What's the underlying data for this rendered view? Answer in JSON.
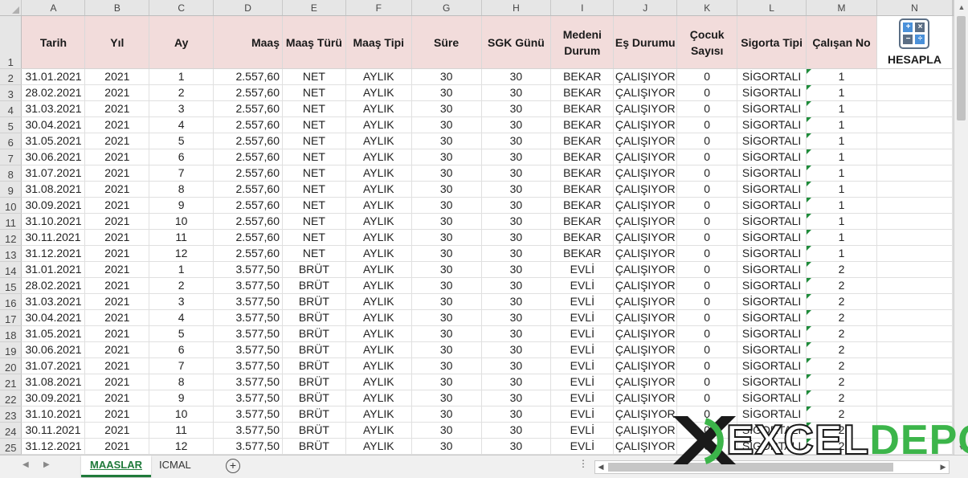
{
  "columns": [
    "A",
    "B",
    "C",
    "D",
    "E",
    "F",
    "G",
    "H",
    "I",
    "J",
    "K",
    "L",
    "M",
    "N"
  ],
  "headers": [
    "Tarih",
    "Yıl",
    "Ay",
    "Maaş",
    "Maaş Türü",
    "Maaş Tipi",
    "Süre",
    "SGK Günü",
    "Medeni Durum",
    "Eş Durumu",
    "Çocuk Sayısı",
    "Sigorta Tipi",
    "Çalışan No"
  ],
  "calc_button_label": "HESAPLA",
  "header_row_number": "1",
  "rows": [
    [
      "2",
      "31.01.2021",
      "2021",
      "1",
      "2.557,60",
      "NET",
      "AYLIK",
      "30",
      "30",
      "BEKAR",
      "ÇALIŞIYOR",
      "0",
      "SİGORTALI",
      "1"
    ],
    [
      "3",
      "28.02.2021",
      "2021",
      "2",
      "2.557,60",
      "NET",
      "AYLIK",
      "30",
      "30",
      "BEKAR",
      "ÇALIŞIYOR",
      "0",
      "SİGORTALI",
      "1"
    ],
    [
      "4",
      "31.03.2021",
      "2021",
      "3",
      "2.557,60",
      "NET",
      "AYLIK",
      "30",
      "30",
      "BEKAR",
      "ÇALIŞIYOR",
      "0",
      "SİGORTALI",
      "1"
    ],
    [
      "5",
      "30.04.2021",
      "2021",
      "4",
      "2.557,60",
      "NET",
      "AYLIK",
      "30",
      "30",
      "BEKAR",
      "ÇALIŞIYOR",
      "0",
      "SİGORTALI",
      "1"
    ],
    [
      "6",
      "31.05.2021",
      "2021",
      "5",
      "2.557,60",
      "NET",
      "AYLIK",
      "30",
      "30",
      "BEKAR",
      "ÇALIŞIYOR",
      "0",
      "SİGORTALI",
      "1"
    ],
    [
      "7",
      "30.06.2021",
      "2021",
      "6",
      "2.557,60",
      "NET",
      "AYLIK",
      "30",
      "30",
      "BEKAR",
      "ÇALIŞIYOR",
      "0",
      "SİGORTALI",
      "1"
    ],
    [
      "8",
      "31.07.2021",
      "2021",
      "7",
      "2.557,60",
      "NET",
      "AYLIK",
      "30",
      "30",
      "BEKAR",
      "ÇALIŞIYOR",
      "0",
      "SİGORTALI",
      "1"
    ],
    [
      "9",
      "31.08.2021",
      "2021",
      "8",
      "2.557,60",
      "NET",
      "AYLIK",
      "30",
      "30",
      "BEKAR",
      "ÇALIŞIYOR",
      "0",
      "SİGORTALI",
      "1"
    ],
    [
      "10",
      "30.09.2021",
      "2021",
      "9",
      "2.557,60",
      "NET",
      "AYLIK",
      "30",
      "30",
      "BEKAR",
      "ÇALIŞIYOR",
      "0",
      "SİGORTALI",
      "1"
    ],
    [
      "11",
      "31.10.2021",
      "2021",
      "10",
      "2.557,60",
      "NET",
      "AYLIK",
      "30",
      "30",
      "BEKAR",
      "ÇALIŞIYOR",
      "0",
      "SİGORTALI",
      "1"
    ],
    [
      "12",
      "30.11.2021",
      "2021",
      "11",
      "2.557,60",
      "NET",
      "AYLIK",
      "30",
      "30",
      "BEKAR",
      "ÇALIŞIYOR",
      "0",
      "SİGORTALI",
      "1"
    ],
    [
      "13",
      "31.12.2021",
      "2021",
      "12",
      "2.557,60",
      "NET",
      "AYLIK",
      "30",
      "30",
      "BEKAR",
      "ÇALIŞIYOR",
      "0",
      "SİGORTALI",
      "1"
    ],
    [
      "14",
      "31.01.2021",
      "2021",
      "1",
      "3.577,50",
      "BRÜT",
      "AYLIK",
      "30",
      "30",
      "EVLİ",
      "ÇALIŞIYOR",
      "0",
      "SİGORTALI",
      "2"
    ],
    [
      "15",
      "28.02.2021",
      "2021",
      "2",
      "3.577,50",
      "BRÜT",
      "AYLIK",
      "30",
      "30",
      "EVLİ",
      "ÇALIŞIYOR",
      "0",
      "SİGORTALI",
      "2"
    ],
    [
      "16",
      "31.03.2021",
      "2021",
      "3",
      "3.577,50",
      "BRÜT",
      "AYLIK",
      "30",
      "30",
      "EVLİ",
      "ÇALIŞIYOR",
      "0",
      "SİGORTALI",
      "2"
    ],
    [
      "17",
      "30.04.2021",
      "2021",
      "4",
      "3.577,50",
      "BRÜT",
      "AYLIK",
      "30",
      "30",
      "EVLİ",
      "ÇALIŞIYOR",
      "0",
      "SİGORTALI",
      "2"
    ],
    [
      "18",
      "31.05.2021",
      "2021",
      "5",
      "3.577,50",
      "BRÜT",
      "AYLIK",
      "30",
      "30",
      "EVLİ",
      "ÇALIŞIYOR",
      "0",
      "SİGORTALI",
      "2"
    ],
    [
      "19",
      "30.06.2021",
      "2021",
      "6",
      "3.577,50",
      "BRÜT",
      "AYLIK",
      "30",
      "30",
      "EVLİ",
      "ÇALIŞIYOR",
      "0",
      "SİGORTALI",
      "2"
    ],
    [
      "20",
      "31.07.2021",
      "2021",
      "7",
      "3.577,50",
      "BRÜT",
      "AYLIK",
      "30",
      "30",
      "EVLİ",
      "ÇALIŞIYOR",
      "0",
      "SİGORTALI",
      "2"
    ],
    [
      "21",
      "31.08.2021",
      "2021",
      "8",
      "3.577,50",
      "BRÜT",
      "AYLIK",
      "30",
      "30",
      "EVLİ",
      "ÇALIŞIYOR",
      "0",
      "SİGORTALI",
      "2"
    ],
    [
      "22",
      "30.09.2021",
      "2021",
      "9",
      "3.577,50",
      "BRÜT",
      "AYLIK",
      "30",
      "30",
      "EVLİ",
      "ÇALIŞIYOR",
      "0",
      "SİGORTALI",
      "2"
    ],
    [
      "23",
      "31.10.2021",
      "2021",
      "10",
      "3.577,50",
      "BRÜT",
      "AYLIK",
      "30",
      "30",
      "EVLİ",
      "ÇALIŞIYOR",
      "0",
      "SİGORTALI",
      "2"
    ],
    [
      "24",
      "30.11.2021",
      "2021",
      "11",
      "3.577,50",
      "BRÜT",
      "AYLIK",
      "30",
      "30",
      "EVLİ",
      "ÇALIŞIYOR",
      "0",
      "SİGORTALI",
      "2"
    ],
    [
      "25",
      "31.12.2021",
      "2021",
      "12",
      "3.577,50",
      "BRÜT",
      "AYLIK",
      "30",
      "30",
      "EVLİ",
      "ÇALIŞIYOR",
      "0",
      "SİGORTALI",
      "2"
    ]
  ],
  "sheets": [
    {
      "label": "MAASLAR",
      "active": true
    },
    {
      "label": "ICMAL",
      "active": false
    }
  ],
  "watermark": {
    "part1": "EXCEL",
    "part2": "DEPO"
  },
  "icons": {
    "calc": "calculator-icon",
    "add": "add-sheet-icon"
  },
  "colors": {
    "header_fill": "#f2dcdb",
    "active_tab": "#1f7a3a",
    "brand_green": "#3cb54a"
  }
}
